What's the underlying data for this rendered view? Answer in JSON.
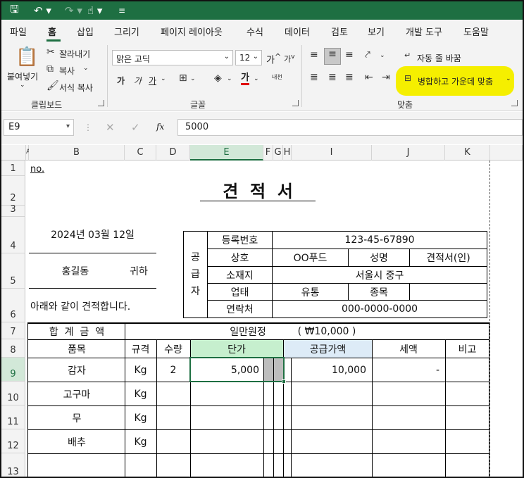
{
  "ribbon_tabs": [
    "파일",
    "홈",
    "삽입",
    "그리기",
    "페이지 레이아웃",
    "수식",
    "데이터",
    "검토",
    "보기",
    "개발 도구",
    "도움말"
  ],
  "clipboard": {
    "paste": "붙여넣기",
    "cut": "잘라내기",
    "copy": "복사",
    "format_painter": "서식 복사",
    "label": "클립보드"
  },
  "font": {
    "name": "맑은 고딕",
    "size": "12",
    "grow": "가",
    "shrink": "가",
    "bold": "가",
    "italic": "가",
    "underline": "가",
    "font_color": "가",
    "phonetic": "내천",
    "label": "글꼴"
  },
  "alignment": {
    "wrap_text": "자동 줄 바꿈",
    "merge_center": "병합하고 가운데 맞춤",
    "label": "맞춤"
  },
  "formula_bar": {
    "name_box": "E9",
    "fx": "fx",
    "value": "5000"
  },
  "colors": {
    "excel_green": "#1e6f42",
    "highlight": "#f5ef00",
    "price_fill": "#c6efce",
    "supply_fill": "#ddebf7"
  },
  "columns": [
    "A",
    "B",
    "C",
    "D",
    "E",
    "F",
    "G",
    "H",
    "I",
    "J",
    "K"
  ],
  "rows": [
    "1",
    "2",
    "3",
    "4",
    "5",
    "6",
    "7",
    "8",
    "9",
    "10",
    "11",
    "12",
    "13"
  ],
  "sheet": {
    "no_label": "no.",
    "title": "견  적  서",
    "date": "2024년 03월 12일",
    "recipient_name": "홍길동",
    "recipient_suffix": "귀하",
    "intro": "아래와 같이 견적합니다.",
    "supplier_vertical": [
      "공",
      "급",
      "자"
    ],
    "reg_no_label": "등록번호",
    "reg_no": "123-45-67890",
    "company_label": "상호",
    "company": "OO푸드",
    "rep_label": "성명",
    "rep": "견적서(인)",
    "address_label": "소재지",
    "address": "서울시 중구",
    "biz_type_label": "업태",
    "biz_type": "유통",
    "biz_item_label": "종목",
    "contact_label": "연락처",
    "contact": "000-0000-0000",
    "total_label": "합  계  금  액",
    "total_words": "일만원정",
    "total_amount": "( ₩10,000 )",
    "headers": [
      "품목",
      "규격",
      "수량",
      "단가",
      "공급가액",
      "세액",
      "비고"
    ],
    "items": [
      {
        "name": "감자",
        "unit": "Kg",
        "qty": "2",
        "price": "5,000",
        "supply": "10,000",
        "tax": "-"
      },
      {
        "name": "고구마",
        "unit": "Kg"
      },
      {
        "name": "무",
        "unit": "Kg"
      },
      {
        "name": "배추",
        "unit": "Kg"
      }
    ]
  }
}
